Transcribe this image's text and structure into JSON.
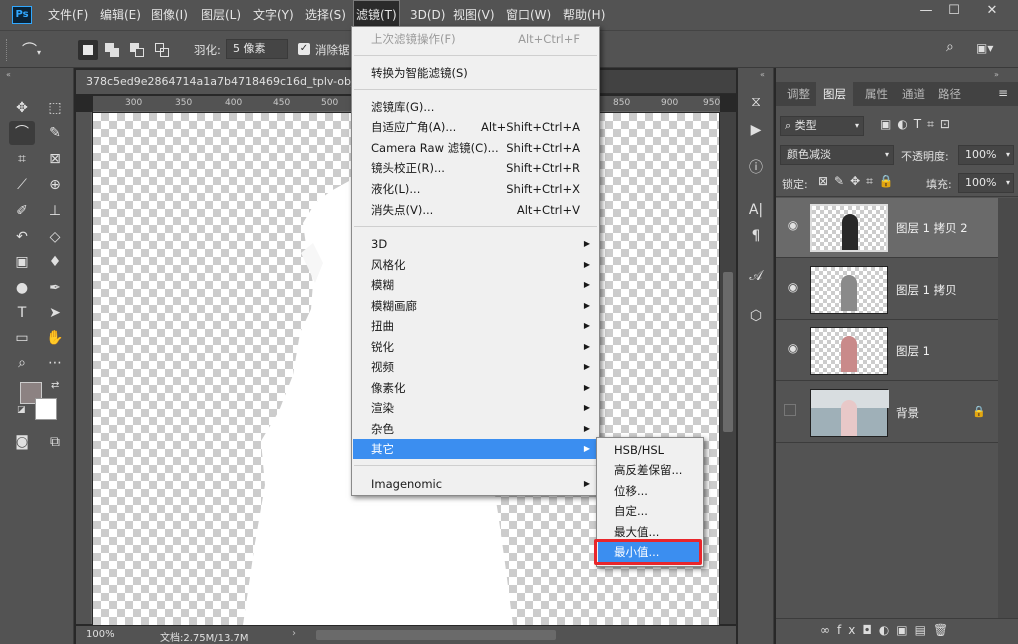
{
  "app": {
    "logo": "Ps"
  },
  "menubar": {
    "items": [
      "文件(F)",
      "编辑(E)",
      "图像(I)",
      "图层(L)",
      "文字(Y)",
      "选择(S)",
      "滤镜(T)",
      "3D(D)",
      "视图(V)",
      "窗口(W)",
      "帮助(H)"
    ],
    "active": "滤镜(T)"
  },
  "window_controls": {
    "minimize": "—",
    "maximize": "☐",
    "close": "✕"
  },
  "options": {
    "feather_label": "羽化:",
    "feather_value": "5 像素",
    "antialias_label": "消除锯",
    "antialias_checked": true
  },
  "document": {
    "tab_title": "378c5ed9e2864714a1a7b4718469c16d_tplv-obj.j",
    "ruler_ticks": [
      "300",
      "350",
      "400",
      "450",
      "500",
      "850",
      "900",
      "950"
    ],
    "zoom": "100%",
    "doc_info": "文档:2.75M/13.7M"
  },
  "filter_menu": {
    "items": [
      {
        "label": "上次滤镜操作(F)",
        "shortcut": "Alt+Ctrl+F",
        "disabled": true
      },
      {
        "label": "转换为智能滤镜(S)"
      },
      {
        "label": "滤镜库(G)..."
      },
      {
        "label": "自适应广角(A)...",
        "shortcut": "Alt+Shift+Ctrl+A"
      },
      {
        "label": "Camera Raw 滤镜(C)...",
        "shortcut": "Shift+Ctrl+A"
      },
      {
        "label": "镜头校正(R)...",
        "shortcut": "Shift+Ctrl+R"
      },
      {
        "label": "液化(L)...",
        "shortcut": "Shift+Ctrl+X"
      },
      {
        "label": "消失点(V)...",
        "shortcut": "Alt+Ctrl+V"
      },
      {
        "label": "3D",
        "submenu": true
      },
      {
        "label": "风格化",
        "submenu": true
      },
      {
        "label": "模糊",
        "submenu": true
      },
      {
        "label": "模糊画廊",
        "submenu": true
      },
      {
        "label": "扭曲",
        "submenu": true
      },
      {
        "label": "锐化",
        "submenu": true
      },
      {
        "label": "视频",
        "submenu": true
      },
      {
        "label": "像素化",
        "submenu": true
      },
      {
        "label": "渲染",
        "submenu": true
      },
      {
        "label": "杂色",
        "submenu": true
      },
      {
        "label": "其它",
        "submenu": true,
        "highlighted": true
      },
      {
        "label": "Imagenomic",
        "submenu": true
      }
    ]
  },
  "other_submenu": {
    "items": [
      "HSB/HSL",
      "高反差保留...",
      "位移...",
      "自定...",
      "最大值...",
      "最小值..."
    ],
    "highlighted_item": "最小值..."
  },
  "panel": {
    "tabs": [
      "调整",
      "图层",
      "属性",
      "通道",
      "路径"
    ],
    "active_tab": "图层",
    "filter_kind": "类型",
    "blend_mode": "颜色减淡",
    "opacity_label": "不透明度:",
    "opacity_value": "100%",
    "lock_label": "锁定:",
    "fill_label": "填充:",
    "fill_value": "100%",
    "layers": [
      {
        "name": "图层 1 拷贝 2",
        "visible": true,
        "selected": true
      },
      {
        "name": "图层 1 拷贝",
        "visible": true
      },
      {
        "name": "图层 1",
        "visible": true
      },
      {
        "name": "背景",
        "visible": false,
        "locked": true
      }
    ]
  },
  "colors": {
    "menu_highlight": "#3b8ef0",
    "callout_red": "#e8262b",
    "ui_gray": "#535353",
    "foreground_swatch": "#8c8282",
    "background_swatch": "#ffffff"
  }
}
